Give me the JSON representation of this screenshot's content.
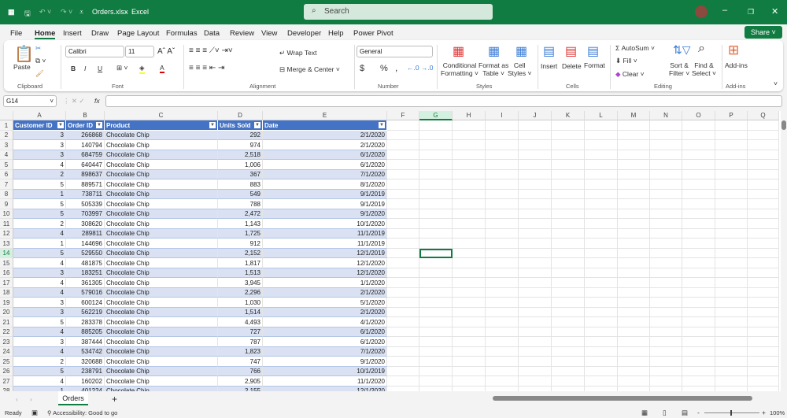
{
  "app": {
    "file_name": "Orders.xlsx",
    "app_name": "Excel",
    "separator": "-",
    "search_placeholder": "Search"
  },
  "menu": [
    "File",
    "Home",
    "Insert",
    "Draw",
    "Page Layout",
    "Formulas",
    "Data",
    "Review",
    "View",
    "Developer",
    "Help",
    "Power Pivot"
  ],
  "share_label": "Share",
  "ribbon": {
    "clipboard": {
      "paste": "Paste",
      "label": "Clipboard"
    },
    "font": {
      "name": "Calibri",
      "size": "11",
      "bold": "B",
      "italic": "I",
      "underline": "U",
      "label": "Font"
    },
    "alignment": {
      "wrap": "Wrap Text",
      "merge": "Merge & Center",
      "label": "Alignment"
    },
    "number": {
      "format": "General",
      "currency": "$",
      "percent": "%",
      "comma": ",",
      "label": "Number"
    },
    "styles": {
      "conditional": "Conditional",
      "conditional2": "Formatting",
      "format_table": "Format as",
      "format_table2": "Table",
      "cell_styles": "Cell",
      "cell_styles2": "Styles",
      "label": "Styles"
    },
    "cells": {
      "insert": "Insert",
      "delete": "Delete",
      "format": "Format",
      "label": "Cells"
    },
    "editing": {
      "autosum": "AutoSum",
      "fill": "Fill",
      "clear": "Clear",
      "sort": "Sort &",
      "sort2": "Filter",
      "find": "Find &",
      "find2": "Select",
      "label": "Editing"
    },
    "addins": {
      "button": "Add-ins",
      "label": "Add-ins"
    }
  },
  "formula_bar": {
    "name_box": "G14",
    "fx": "fx",
    "value": ""
  },
  "columns": [
    "A",
    "B",
    "C",
    "D",
    "E",
    "F",
    "G",
    "H",
    "I",
    "J",
    "K",
    "L",
    "M",
    "N",
    "O",
    "P",
    "Q"
  ],
  "table": {
    "headers": [
      "Customer ID",
      "Order ID",
      "Product",
      "Units Sold",
      "Date"
    ],
    "rows": [
      [
        "3",
        "266868",
        "Chocolate Chip",
        "292",
        "2/1/2020"
      ],
      [
        "3",
        "140794",
        "Chocolate Chip",
        "974",
        "2/1/2020"
      ],
      [
        "3",
        "684759",
        "Chocolate Chip",
        "2,518",
        "6/1/2020"
      ],
      [
        "4",
        "640447",
        "Chocolate Chip",
        "1,006",
        "6/1/2020"
      ],
      [
        "2",
        "898637",
        "Chocolate Chip",
        "367",
        "7/1/2020"
      ],
      [
        "5",
        "889571",
        "Chocolate Chip",
        "883",
        "8/1/2020"
      ],
      [
        "1",
        "738711",
        "Chocolate Chip",
        "549",
        "9/1/2019"
      ],
      [
        "5",
        "505339",
        "Chocolate Chip",
        "788",
        "9/1/2019"
      ],
      [
        "5",
        "703997",
        "Chocolate Chip",
        "2,472",
        "9/1/2020"
      ],
      [
        "2",
        "308620",
        "Chocolate Chip",
        "1,143",
        "10/1/2020"
      ],
      [
        "4",
        "289811",
        "Chocolate Chip",
        "1,725",
        "11/1/2019"
      ],
      [
        "1",
        "144696",
        "Chocolate Chip",
        "912",
        "11/1/2019"
      ],
      [
        "5",
        "529550",
        "Chocolate Chip",
        "2,152",
        "12/1/2019"
      ],
      [
        "4",
        "481875",
        "Chocolate Chip",
        "1,817",
        "12/1/2020"
      ],
      [
        "3",
        "183251",
        "Chocolate Chip",
        "1,513",
        "12/1/2020"
      ],
      [
        "4",
        "361305",
        "Chocolate Chip",
        "3,945",
        "1/1/2020"
      ],
      [
        "4",
        "579016",
        "Chocolate Chip",
        "2,296",
        "2/1/2020"
      ],
      [
        "3",
        "600124",
        "Chocolate Chip",
        "1,030",
        "5/1/2020"
      ],
      [
        "3",
        "562219",
        "Chocolate Chip",
        "1,514",
        "2/1/2020"
      ],
      [
        "5",
        "283378",
        "Chocolate Chip",
        "4,493",
        "4/1/2020"
      ],
      [
        "4",
        "885205",
        "Chocolate Chip",
        "727",
        "6/1/2020"
      ],
      [
        "3",
        "387444",
        "Chocolate Chip",
        "787",
        "6/1/2020"
      ],
      [
        "4",
        "534742",
        "Chocolate Chip",
        "1,823",
        "7/1/2020"
      ],
      [
        "2",
        "320688",
        "Chocolate Chip",
        "747",
        "9/1/2020"
      ],
      [
        "5",
        "238791",
        "Chocolate Chip",
        "766",
        "10/1/2019"
      ],
      [
        "4",
        "160202",
        "Chocolate Chip",
        "2,905",
        "11/1/2020"
      ],
      [
        "1",
        "401224",
        "Chocolate Chip",
        "2,155",
        "12/1/2020"
      ]
    ]
  },
  "sheet_tab": "Orders",
  "add_sheet": "+",
  "status": {
    "ready": "Ready",
    "accessibility": "Accessibility: Good to go",
    "zoom": "100%",
    "minus": "-",
    "plus": "+"
  }
}
